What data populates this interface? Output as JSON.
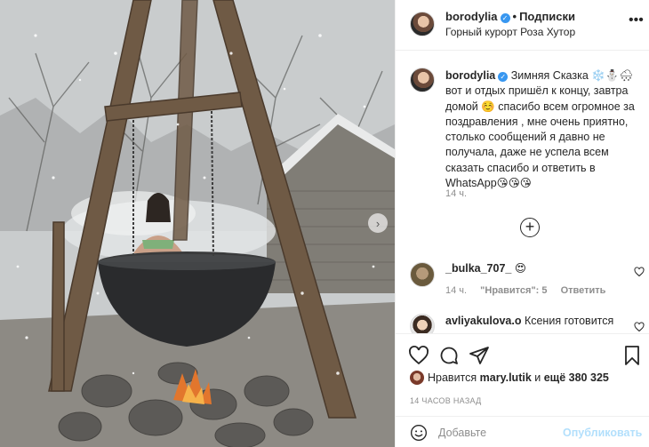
{
  "post": {
    "username": "borodylia",
    "follow_label": "Подписки",
    "location": "Горный курорт Роза Хутор",
    "more_icon": "more-horizontal-icon",
    "verified_icon": "verified-badge-icon"
  },
  "caption": {
    "username": "borodylia",
    "text": "Зимняя Сказка ❄️⛄️🌨 вот и отдых пришёл к концу, завтра домой ☺️ спасибо всем огромное за поздравления , мне очень приятно, столько сообщений я давно не получала, даже не успела всем сказать спасибо и ответить в WhatsApp😘😘😘",
    "time": "14 ч."
  },
  "load_more_icon": "plus-circle-icon",
  "comments": [
    {
      "username": "_bulka_707_",
      "text": "😍",
      "time": "14 ч.",
      "likes": "\"Нравится\": 5",
      "reply_label": "Ответить"
    },
    {
      "username": "avliyakulova.o",
      "text": "Ксения готовится"
    }
  ],
  "actions": {
    "like_icon": "heart-icon",
    "comment_icon": "comment-icon",
    "share_icon": "send-icon",
    "save_icon": "bookmark-icon"
  },
  "likes": {
    "prefix": "Нравится",
    "user": "mary.lutik",
    "middle": "и",
    "others": "ещё 380 325"
  },
  "timestamp": "14 ЧАСОВ НАЗАД",
  "add_comment": {
    "placeholder": "Добавьте",
    "publish_label": "Опубликовать",
    "emoji_icon": "emoji-smile-icon"
  },
  "photo": {
    "next_icon": "chevron-right-icon"
  }
}
